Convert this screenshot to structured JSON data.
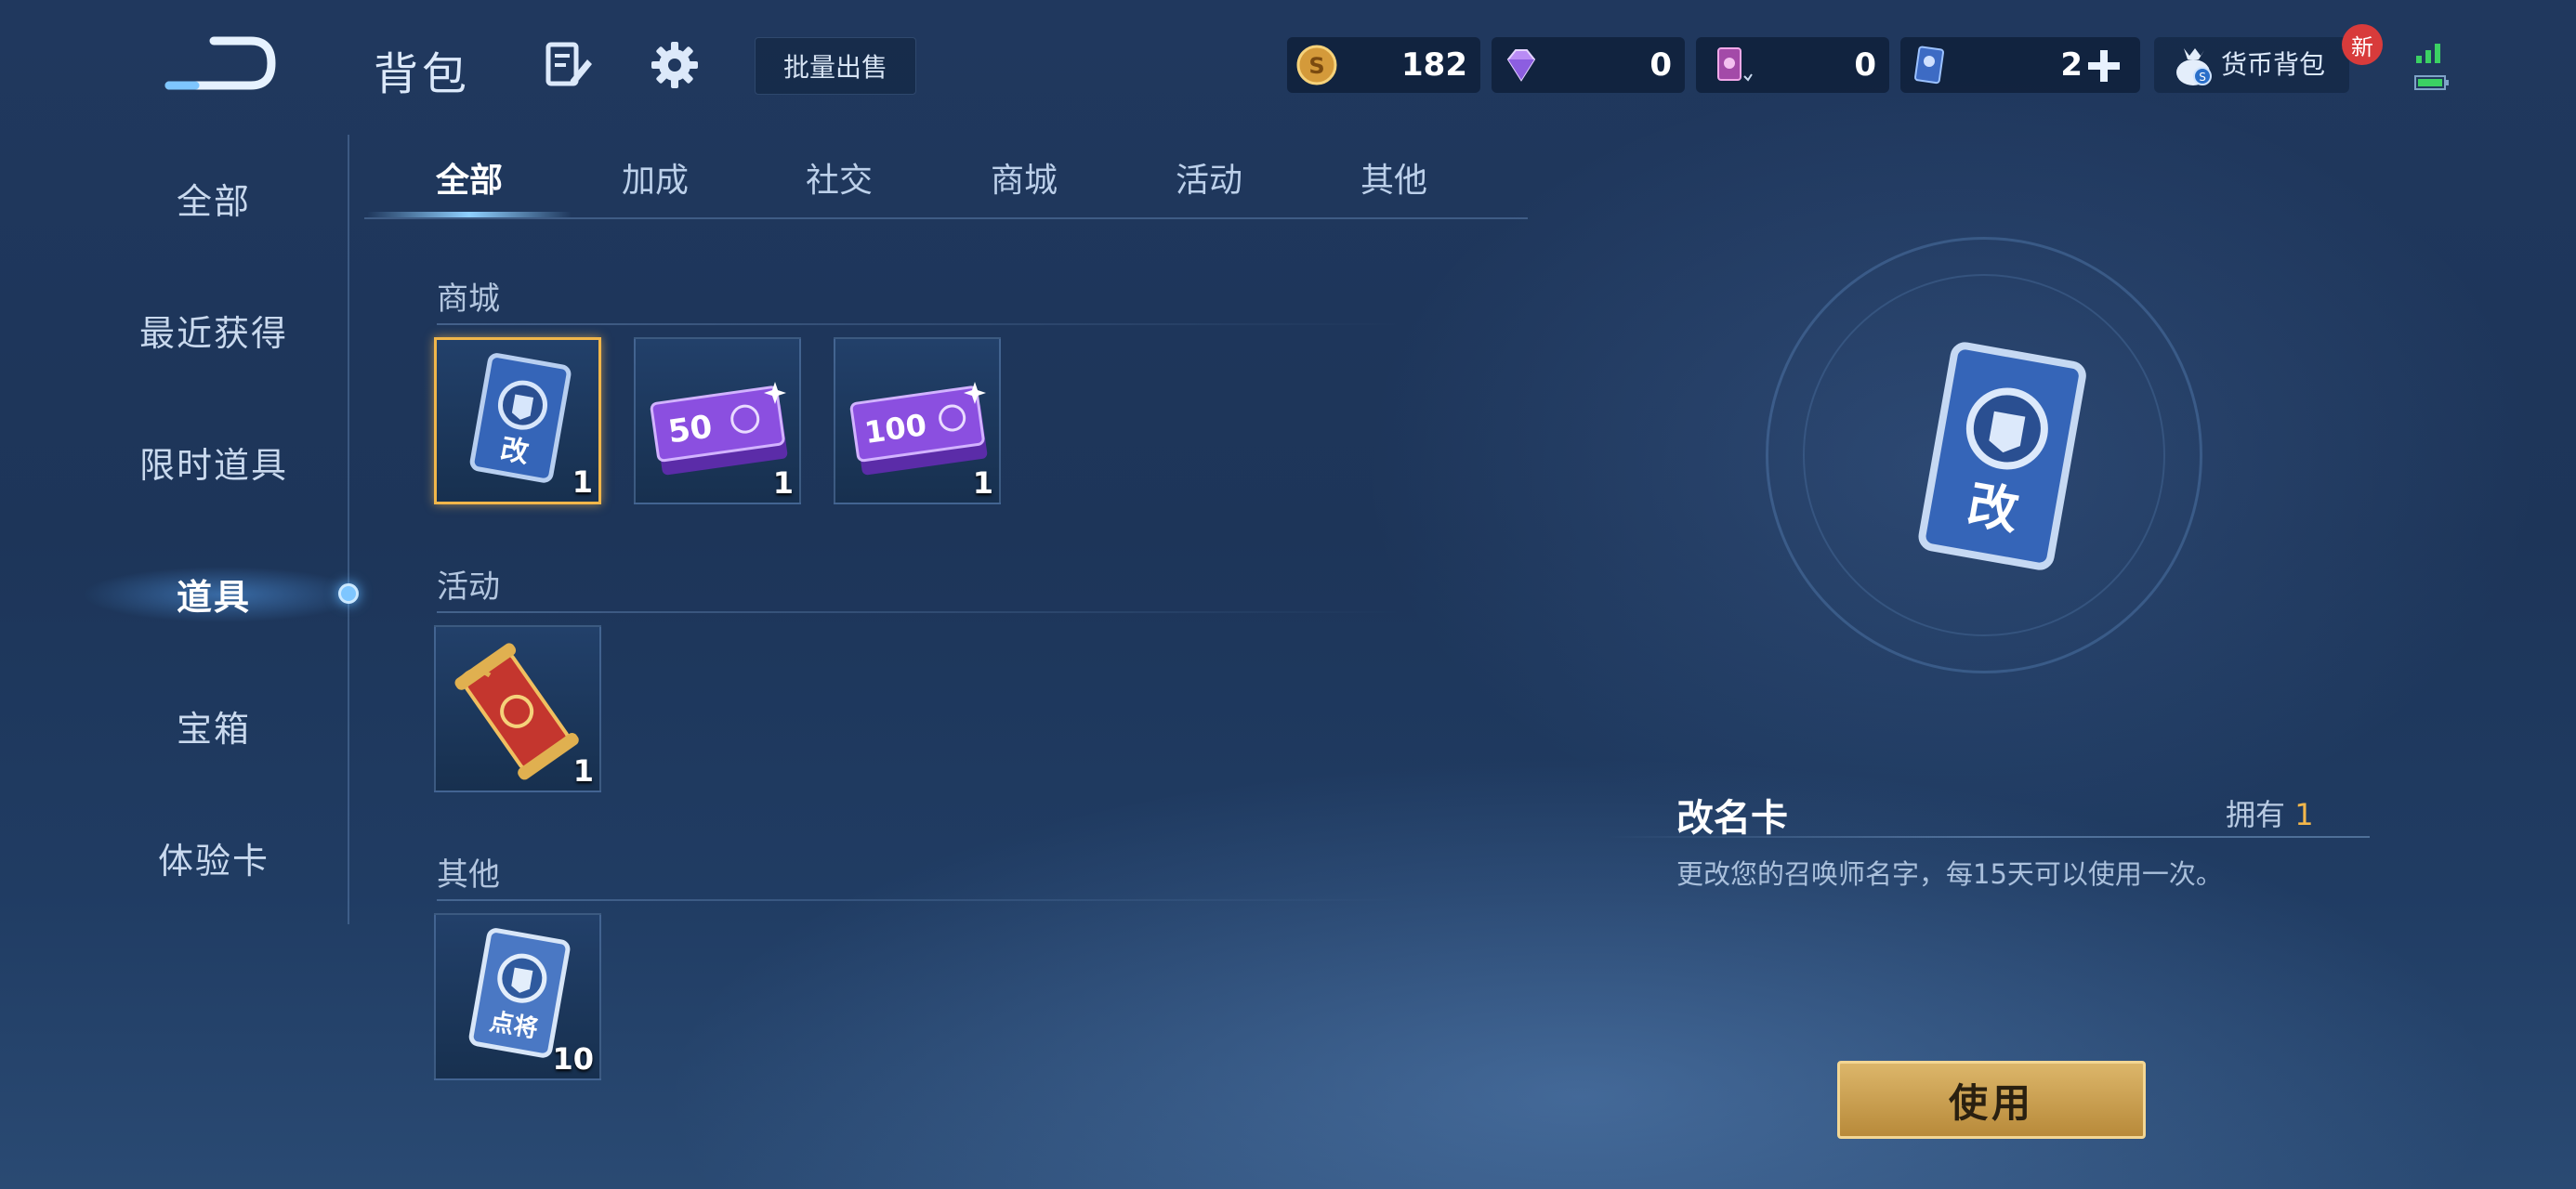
{
  "header": {
    "title": "背包",
    "batch_sell": "批量出售",
    "currencies": [
      {
        "icon": "gold-coin-icon",
        "value": "182"
      },
      {
        "icon": "diamond-icon",
        "value": "0"
      },
      {
        "icon": "card-currency-icon",
        "value": "0"
      },
      {
        "icon": "blue-card-icon",
        "value": "2"
      }
    ],
    "wallet_label": "货币背包",
    "new_badge": "新"
  },
  "sidebar": {
    "items": [
      {
        "label": "全部"
      },
      {
        "label": "最近获得"
      },
      {
        "label": "限时道具"
      },
      {
        "label": "道具"
      },
      {
        "label": "宝箱"
      },
      {
        "label": "体验卡"
      }
    ],
    "active_index": 3
  },
  "tabs": {
    "items": [
      {
        "label": "全部"
      },
      {
        "label": "加成"
      },
      {
        "label": "社交"
      },
      {
        "label": "商城"
      },
      {
        "label": "活动"
      },
      {
        "label": "其他"
      }
    ],
    "active_index": 0
  },
  "sections": [
    {
      "title": "商城",
      "items": [
        {
          "icon": "rename-card-icon",
          "card_text": "改",
          "count": "1"
        },
        {
          "icon": "ticket-50-icon",
          "card_text": "50",
          "count": "1"
        },
        {
          "icon": "ticket-100-icon",
          "card_text": "100",
          "count": "1"
        }
      ]
    },
    {
      "title": "活动",
      "items": [
        {
          "icon": "scroll-icon",
          "count": "1"
        }
      ]
    },
    {
      "title": "其他",
      "items": [
        {
          "icon": "hero-card-icon",
          "card_text": "点将",
          "count": "10"
        }
      ]
    }
  ],
  "detail": {
    "name": "改名卡",
    "own_label": "拥有",
    "own_count": "1",
    "description": "更改您的召唤师名字，每15天可以使用一次。",
    "preview_text": "改",
    "use_button": "使用"
  },
  "colors": {
    "accent_gold": "#f1b64a",
    "background": "#1d3559",
    "highlight_blue": "#7ec6ff"
  }
}
